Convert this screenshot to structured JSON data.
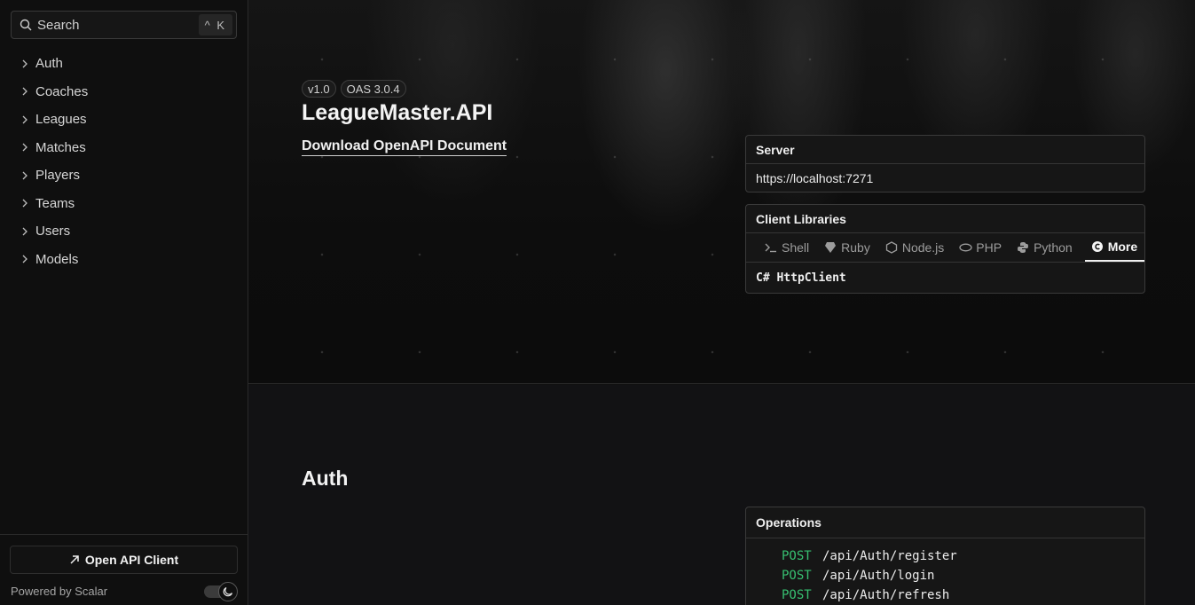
{
  "search": {
    "placeholder": "Search",
    "shortcut": "^ K"
  },
  "sidebar": {
    "items": [
      {
        "label": "Auth"
      },
      {
        "label": "Coaches"
      },
      {
        "label": "Leagues"
      },
      {
        "label": "Matches"
      },
      {
        "label": "Players"
      },
      {
        "label": "Teams"
      },
      {
        "label": "Users"
      },
      {
        "label": "Models"
      }
    ],
    "open_client_label": "Open API Client",
    "powered_by": "Powered by Scalar"
  },
  "hero": {
    "version_badge": "v1.0",
    "oas_badge": "OAS 3.0.4",
    "title": "LeagueMaster.API",
    "download_link": "Download OpenAPI Document"
  },
  "server": {
    "heading": "Server",
    "url": "https://localhost:7271"
  },
  "client_libraries": {
    "heading": "Client Libraries",
    "tabs": [
      {
        "label": "Shell",
        "icon": "terminal-icon"
      },
      {
        "label": "Ruby",
        "icon": "ruby-icon"
      },
      {
        "label": "Node.js",
        "icon": "nodejs-icon"
      },
      {
        "label": "PHP",
        "icon": "php-icon"
      },
      {
        "label": "Python",
        "icon": "python-icon"
      },
      {
        "label": "More",
        "icon": "csharp-icon",
        "active": true
      }
    ],
    "selected": "C# HttpClient"
  },
  "auth_section": {
    "title": "Auth",
    "operations_heading": "Operations",
    "operations": [
      {
        "method": "POST",
        "path": "/api/Auth/register"
      },
      {
        "method": "POST",
        "path": "/api/Auth/login"
      },
      {
        "method": "POST",
        "path": "/api/Auth/refresh"
      }
    ]
  },
  "colors": {
    "post_method": "#37c071",
    "background": "#0f0f0f"
  }
}
